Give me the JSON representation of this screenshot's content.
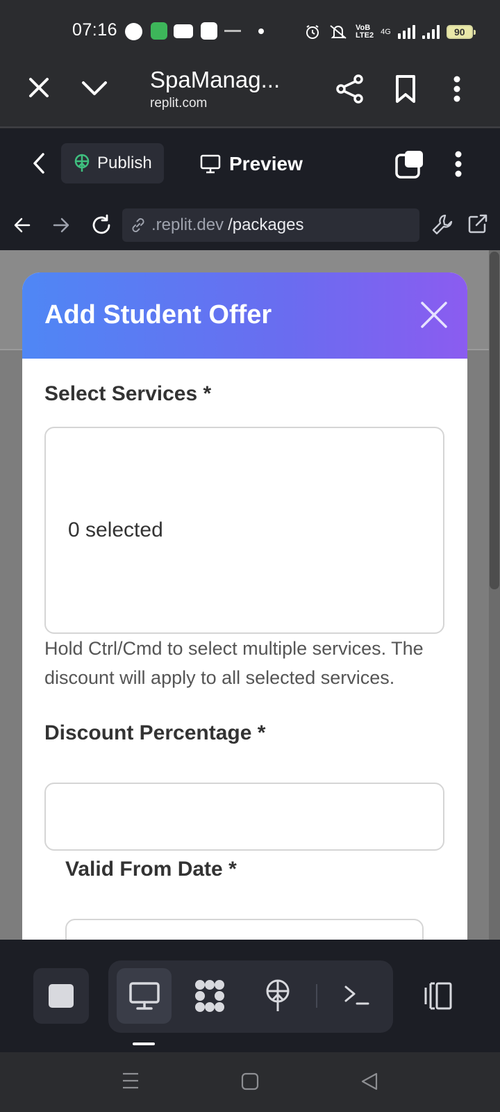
{
  "status_bar": {
    "time": "07:16",
    "battery": "90",
    "network": "4G",
    "icons": [
      "message-icon",
      "app-icon",
      "youtube-icon",
      "s-app-icon",
      "alarm-icon",
      "mute-icon",
      "volte-icon",
      "signal-icon"
    ]
  },
  "browser": {
    "tab_title": "SpaManag...",
    "domain": "replit.com"
  },
  "replit_toolbar": {
    "publish_label": "Publish",
    "preview_label": "Preview"
  },
  "url_bar": {
    "host": ".replit.dev",
    "path": "/packages"
  },
  "modal": {
    "title": "Add Student Offer",
    "services_label": "Select Services *",
    "services_count": "0 selected",
    "services_hint": "Hold Ctrl/Cmd to select multiple services. The discount will apply to all selected services.",
    "discount_label": "Discount Percentage *",
    "discount_value": "",
    "valid_from_label": "Valid From Date *",
    "valid_from_value": ""
  },
  "dock": {
    "items": [
      "stop",
      "preview",
      "agent",
      "publish",
      "shell",
      "layout"
    ]
  },
  "colors": {
    "header_gradient_start": "#4f87f5",
    "header_gradient_end": "#8b5cf0",
    "publish_icon": "#3fbf7f"
  }
}
